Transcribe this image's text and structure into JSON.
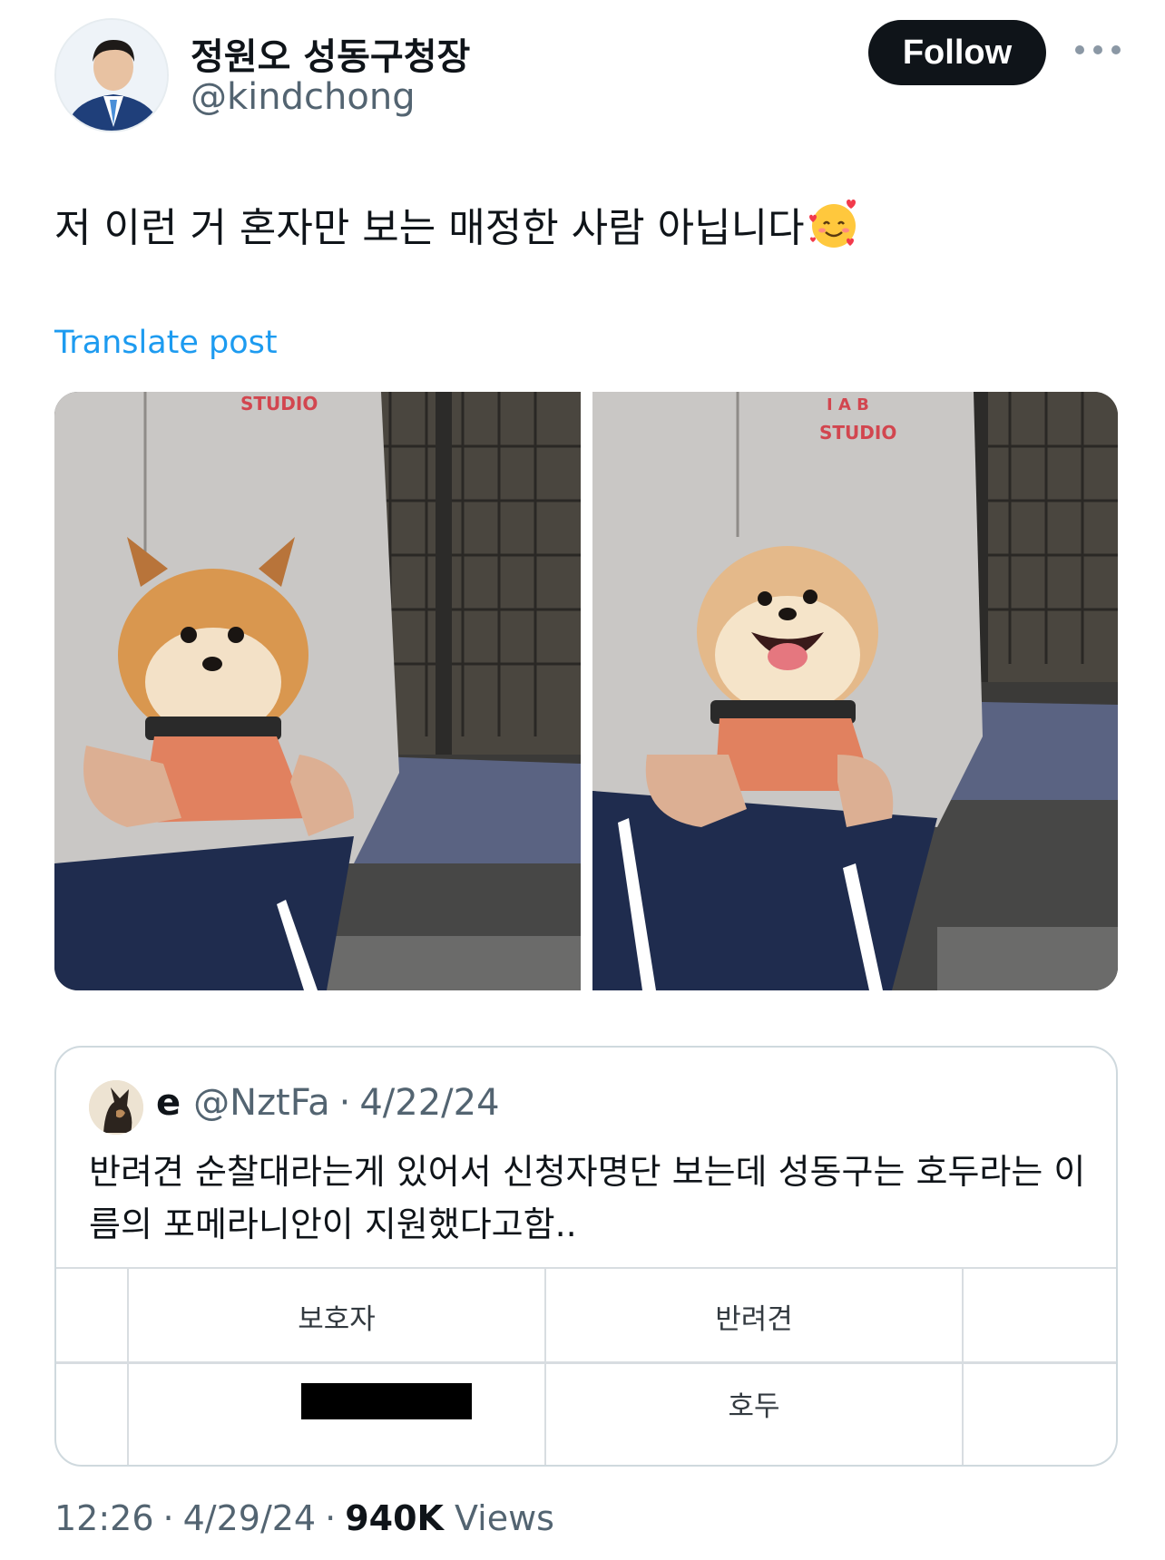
{
  "author": {
    "display_name": "정원오 성동구청장",
    "handle": "@kindchong",
    "follow_label": "Follow",
    "more_icon": "more-horizontal-icon"
  },
  "post": {
    "text": "저 이런 거 혼자만 보는 매정한 사람 아닙니다",
    "emoji": "smiling-face-with-hearts",
    "translate_label": "Translate post"
  },
  "media": [
    {
      "alt": "studio-hoodie-dog-photo-1"
    },
    {
      "alt": "studio-hoodie-dog-photo-2"
    }
  ],
  "quoted_post": {
    "display_name": "e",
    "handle": "@NztFa",
    "dot": "·",
    "date": "4/22/24",
    "text": "반려견 순찰대라는게 있어서 신청자명단 보는데 성동구는 호두라는 이름의 포메라니안이 지원했다고함..",
    "table": {
      "headers": [
        "보호자",
        "반려견"
      ],
      "rows": [
        [
          "",
          "호두"
        ]
      ]
    }
  },
  "footer": {
    "time": "12:26",
    "dot1": "·",
    "date": "4/29/24",
    "dot2": "·",
    "views_count": "940K",
    "views_label": "Views"
  },
  "colors": {
    "link": "#1d9bf0",
    "text": "#0f1419",
    "muted": "#536471",
    "button": "#0f1419"
  }
}
